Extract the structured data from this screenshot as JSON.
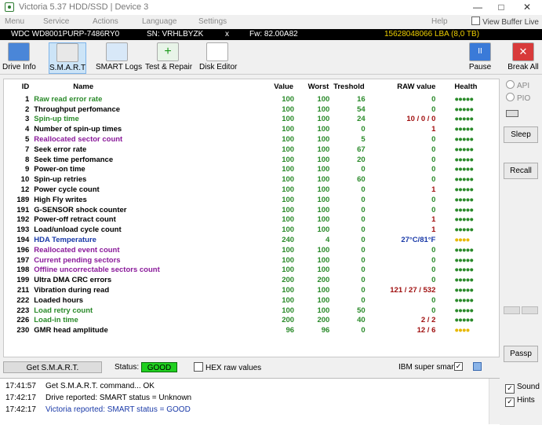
{
  "window": {
    "title": "Victoria 5.37 HDD/SSD | Device 3"
  },
  "menu": {
    "items": [
      "Menu",
      "Service",
      "Actions",
      "Language",
      "Settings",
      "Help"
    ],
    "view_buffer": "View Buffer Live"
  },
  "drive": {
    "model": "WDC WD8001PURP-7486RY0",
    "serial": "SN: VRHLBYZK",
    "close": "x",
    "firmware": "Fw: 82.00A82",
    "lba": "15628048066 LBA (8,0 TB)"
  },
  "toolbar": {
    "drive_info": "Drive Info",
    "smart": "S.M.A.R.T",
    "smart_logs": "SMART Logs",
    "test_repair": "Test & Repair",
    "disk_editor": "Disk Editor",
    "pause": "Pause",
    "break_all": "Break All"
  },
  "table": {
    "headers": {
      "id": "ID",
      "name": "Name",
      "value": "Value",
      "worst": "Worst",
      "threshold": "Treshold",
      "raw": "RAW value",
      "health": "Health"
    },
    "rows": [
      {
        "id": "1",
        "name": "Raw read error rate",
        "value": "100",
        "worst": "100",
        "threshold": "16",
        "raw": "0",
        "health": "●●●●●"
      },
      {
        "id": "2",
        "name": "Throughput perfomance",
        "value": "100",
        "worst": "100",
        "threshold": "54",
        "raw": "0",
        "health": "●●●●●"
      },
      {
        "id": "3",
        "name": "Spin-up time",
        "value": "100",
        "worst": "100",
        "threshold": "24",
        "raw": "10 / 0 / 0",
        "health": "●●●●●"
      },
      {
        "id": "4",
        "name": "Number of spin-up times",
        "value": "100",
        "worst": "100",
        "threshold": "0",
        "raw": "1",
        "health": "●●●●●"
      },
      {
        "id": "5",
        "name": "Reallocated sector count",
        "value": "100",
        "worst": "100",
        "threshold": "5",
        "raw": "0",
        "health": "●●●●●"
      },
      {
        "id": "7",
        "name": "Seek error rate",
        "value": "100",
        "worst": "100",
        "threshold": "67",
        "raw": "0",
        "health": "●●●●●"
      },
      {
        "id": "8",
        "name": "Seek time perfomance",
        "value": "100",
        "worst": "100",
        "threshold": "20",
        "raw": "0",
        "health": "●●●●●"
      },
      {
        "id": "9",
        "name": "Power-on time",
        "value": "100",
        "worst": "100",
        "threshold": "0",
        "raw": "0",
        "health": "●●●●●"
      },
      {
        "id": "10",
        "name": "Spin-up retries",
        "value": "100",
        "worst": "100",
        "threshold": "60",
        "raw": "0",
        "health": "●●●●●"
      },
      {
        "id": "12",
        "name": "Power cycle count",
        "value": "100",
        "worst": "100",
        "threshold": "0",
        "raw": "1",
        "health": "●●●●●"
      },
      {
        "id": "189",
        "name": "High Fly writes",
        "value": "100",
        "worst": "100",
        "threshold": "0",
        "raw": "0",
        "health": "●●●●●"
      },
      {
        "id": "191",
        "name": "G-SENSOR shock counter",
        "value": "100",
        "worst": "100",
        "threshold": "0",
        "raw": "0",
        "health": "●●●●●"
      },
      {
        "id": "192",
        "name": "Power-off retract count",
        "value": "100",
        "worst": "100",
        "threshold": "0",
        "raw": "1",
        "health": "●●●●●"
      },
      {
        "id": "193",
        "name": "Load/unload cycle count",
        "value": "100",
        "worst": "100",
        "threshold": "0",
        "raw": "1",
        "health": "●●●●●"
      },
      {
        "id": "194",
        "name": "HDA Temperature",
        "value": "240",
        "worst": "4",
        "threshold": "0",
        "raw": "27°C/81°F",
        "health": "●●●●"
      },
      {
        "id": "196",
        "name": "Reallocated event count",
        "value": "100",
        "worst": "100",
        "threshold": "0",
        "raw": "0",
        "health": "●●●●●"
      },
      {
        "id": "197",
        "name": "Current pending sectors",
        "value": "100",
        "worst": "100",
        "threshold": "0",
        "raw": "0",
        "health": "●●●●●"
      },
      {
        "id": "198",
        "name": "Offline uncorrectable sectors count",
        "value": "100",
        "worst": "100",
        "threshold": "0",
        "raw": "0",
        "health": "●●●●●"
      },
      {
        "id": "199",
        "name": "Ultra DMA CRC errors",
        "value": "200",
        "worst": "200",
        "threshold": "0",
        "raw": "0",
        "health": "●●●●●"
      },
      {
        "id": "211",
        "name": "Vibration during read",
        "value": "100",
        "worst": "100",
        "threshold": "0",
        "raw": "121 / 27 / 532",
        "health": "●●●●●"
      },
      {
        "id": "222",
        "name": "Loaded hours",
        "value": "100",
        "worst": "100",
        "threshold": "0",
        "raw": "0",
        "health": "●●●●●"
      },
      {
        "id": "223",
        "name": "Load retry count",
        "value": "100",
        "worst": "100",
        "threshold": "50",
        "raw": "0",
        "health": "●●●●●"
      },
      {
        "id": "226",
        "name": "Load-in time",
        "value": "200",
        "worst": "200",
        "threshold": "40",
        "raw": "2 / 2",
        "health": "●●●●●"
      },
      {
        "id": "230",
        "name": "GMR head amplitude",
        "value": "96",
        "worst": "96",
        "threshold": "0",
        "raw": "12 / 6",
        "health": "●●●●"
      }
    ]
  },
  "right_panel": {
    "api": "API",
    "pio": "PIO",
    "sleep": "Sleep",
    "recall": "Recall",
    "passp": "Passp"
  },
  "status": {
    "get_smart": "Get S.M.A.R.T.",
    "label": "Status:",
    "value": "GOOD",
    "hex_raw": "HEX raw values",
    "ibm": "IBM super smart:",
    "ibm_check": "✓"
  },
  "log": [
    {
      "time": "17:41:57",
      "msg": "Get S.M.A.R.T. command... OK"
    },
    {
      "time": "17:42:17",
      "msg": "Drive reported: SMART status = Unknown"
    },
    {
      "time": "17:42:17",
      "msg": "Victoria reported: SMART status = GOOD"
    }
  ],
  "bottom": {
    "sound": "Sound",
    "hints": "Hints"
  }
}
